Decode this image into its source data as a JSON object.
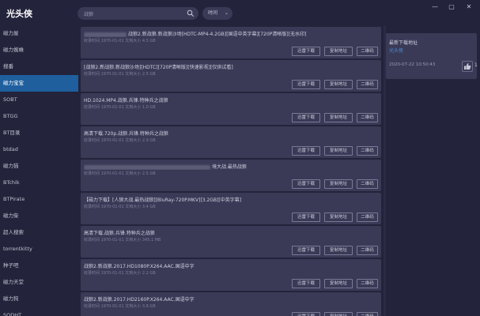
{
  "app": {
    "title": "光头侠"
  },
  "search": {
    "value": "战狼",
    "placeholder": ""
  },
  "time_filter": {
    "label": "时间"
  },
  "sidebar": {
    "items": [
      {
        "label": "磁力屋"
      },
      {
        "label": "磁力蜘蛛"
      },
      {
        "label": "搜番"
      },
      {
        "label": "磁力宝宝"
      },
      {
        "label": "SOBT"
      },
      {
        "label": "BTGG"
      },
      {
        "label": "BT目录"
      },
      {
        "label": "btdad"
      },
      {
        "label": "磁力猫"
      },
      {
        "label": "BTchik"
      },
      {
        "label": "BTPirate"
      },
      {
        "label": "磁力柴"
      },
      {
        "label": "超人搜索"
      },
      {
        "label": "torrentkitty"
      },
      {
        "label": "种子吧"
      },
      {
        "label": "磁力天堂"
      },
      {
        "label": "磁力狗"
      },
      {
        "label": "SODHT"
      }
    ],
    "active_index": 3
  },
  "buttons": {
    "thunder": "迅雷下载",
    "copy": "复制地址",
    "qr": "二维码"
  },
  "results": [
    {
      "title": "战狼2.新战狼.新战狼沙场[HDTC-MP4-4.2GB][国语中英字幕][720P清晰版][无水印]",
      "meta": "收录时间 1970-01-01 文档大小 4.5 GB",
      "redacted_prefix": true
    },
    {
      "title": "[战狼2.新战狼.新战狼沙场][HDTC][720P清晰版][快速影视][仅供试看]",
      "meta": "收录时间 1970-01-01 文档大小 2.5 GB",
      "redacted_prefix": false
    },
    {
      "title": "HD.1024.MP4.战狼.兵锋.特种兵之战狼",
      "meta": "收录时间 1970-01-01 文档大小 1.0 GB",
      "redacted_prefix": false
    },
    {
      "title": "高清下载.720p.战狼.兵锋.特种兵之战狼",
      "meta": "收录时间 1970-01-01 文档大小 2.9 GB",
      "redacted_prefix": false
    },
    {
      "title": "境大战.最热战狼",
      "meta": "收录时间 1970-01-01 文档大小 2.5 GB",
      "redacted_prefix": true
    },
    {
      "title": "【磁力下载】[人狼大战.最热战狼][BluRay-720P.MKV][3.2GB][中英字幕]",
      "meta": "收录时间 1970-01-01 文档大小 3.4 GB",
      "redacted_prefix": false
    },
    {
      "title": "高清下载.战狼.兵锋.特种兵之战狼",
      "meta": "收录时间 1970-01-01 文档大小 345.1 MB",
      "redacted_prefix": false
    },
    {
      "title": "战狼2.新战狼.2017.HD1080P.X264.AAC.国语中字",
      "meta": "收录时间 1970-01-01 文档大小 2.2 GB",
      "redacted_prefix": false
    },
    {
      "title": "战狼2.新战狼.2017.HD2160P.X264.AAC.国语中字",
      "meta": "收录时间 1970-01-01 文档大小 3.8 GB",
      "redacted_prefix": false
    }
  ],
  "right_panel": {
    "title": "最新下载地址",
    "link": "光头侠",
    "time": "2020-07-22 10:50:43",
    "like_count": "1"
  },
  "colors": {
    "background": "#23233b",
    "card": "#3a3a57",
    "active": "#1f5f9e",
    "link": "#4e8fd6"
  },
  "icons": [
    "search-icon",
    "minimize-icon",
    "maximize-icon",
    "close-icon",
    "thumb-up-icon",
    "chevron-down-icon"
  ]
}
